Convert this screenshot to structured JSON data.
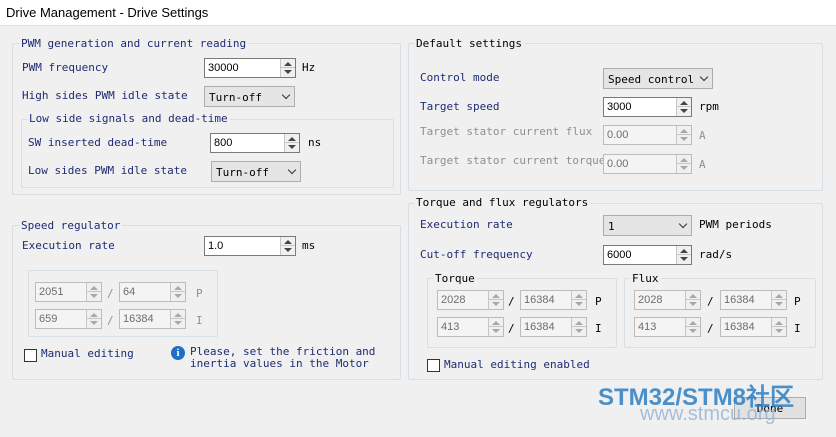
{
  "window": {
    "title": "Drive Management - Drive Settings"
  },
  "pwm": {
    "group_title": "PWM generation and current reading",
    "freq_label": "PWM frequency",
    "freq_value": "30000",
    "freq_unit": "Hz",
    "high_idle_label": "High sides PWM idle state",
    "high_idle_value": "Turn-off",
    "low_side": {
      "group_title": "Low side signals and dead-time",
      "deadtime_label": "SW inserted dead-time",
      "deadtime_value": "800",
      "deadtime_unit": "ns",
      "low_idle_label": "Low sides PWM idle state",
      "low_idle_value": "Turn-off"
    }
  },
  "speed_reg": {
    "group_title": "Speed regulator",
    "exec_label": "Execution rate",
    "exec_value": "1.0",
    "exec_unit": "ms",
    "p_num": "2051",
    "p_den": "64",
    "p_label": "P",
    "i_num": "659",
    "i_den": "16384",
    "i_label": "I",
    "slash": "/",
    "manual_label": "Manual editing",
    "note": "Please, set the friction and inertia values in the Motor"
  },
  "defaults": {
    "group_title": "Default settings",
    "control_mode_label": "Control mode",
    "control_mode_value": "Speed control",
    "target_speed_label": "Target speed",
    "target_speed_value": "3000",
    "target_speed_unit": "rpm",
    "flux_label": "Target stator current flux",
    "flux_value": "0.00",
    "flux_unit": "A",
    "torque_label": "Target stator current torque",
    "torque_value": "0.00",
    "torque_unit": "A"
  },
  "tf_reg": {
    "group_title": "Torque and flux regulators",
    "exec_label": "Execution rate",
    "exec_value": "1",
    "exec_unit": "PWM periods",
    "cutoff_label": "Cut-off frequency",
    "cutoff_value": "6000",
    "cutoff_unit": "rad/s",
    "torque": {
      "title": "Torque",
      "p_num": "2028",
      "p_den": "16384",
      "p_label": "P",
      "i_num": "413",
      "i_den": "16384",
      "i_label": "I"
    },
    "flux": {
      "title": "Flux",
      "p_num": "2028",
      "p_den": "16384",
      "p_label": "P",
      "i_num": "413",
      "i_den": "16384",
      "i_label": "I"
    },
    "slash": "/",
    "manual_label": "Manual editing enabled"
  },
  "done_label": "Done",
  "watermark": {
    "line1a": "STM32/STM8",
    "line1b": "社区",
    "line2": "www.stmcu.org"
  }
}
